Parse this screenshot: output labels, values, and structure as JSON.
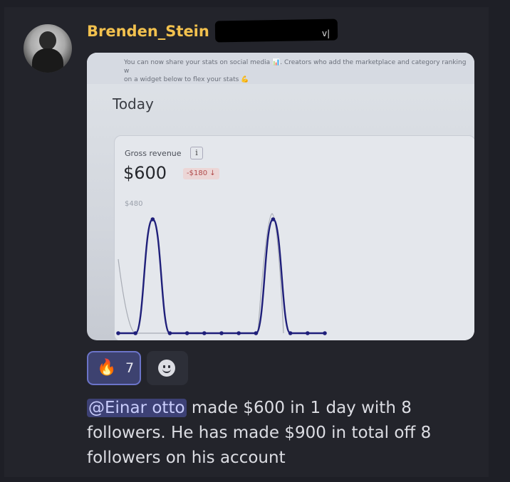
{
  "post": {
    "username": "Brenden_Stein",
    "redaction_tail": "v|"
  },
  "screenshot": {
    "banner": {
      "text_line1": "You can now share your stats on social media 📊. Creators who add the marketplace and category ranking w",
      "text_line2": "on a widget below to flex your stats 💪"
    },
    "period": "Today",
    "card": {
      "label": "Gross revenue",
      "info_icon_glyph": "i",
      "amount": "$600",
      "delta": "-$180 ↓",
      "ytick": "$480"
    }
  },
  "chart_data": {
    "type": "line",
    "title": "",
    "ylim": [
      0,
      600
    ],
    "series": [
      {
        "values": [
          0,
          0,
          480,
          0,
          0,
          0,
          0,
          0,
          0,
          480,
          0,
          0,
          0
        ],
        "color": "#1f1f7a"
      }
    ]
  },
  "reactions": [
    {
      "emoji": "🔥",
      "count": "7"
    }
  ],
  "add_reaction_icon": "smiley-face-icon",
  "message": {
    "mention": "@Einar otto",
    "text": " made $600 in 1 day with 8 followers. He has made $900 in total off 8 followers on his account"
  },
  "colors": {
    "username": "#f2c14e",
    "mention_bg": "#3d4175",
    "reaction_bg": "#3d4270",
    "reaction_border": "#6b74c9"
  }
}
